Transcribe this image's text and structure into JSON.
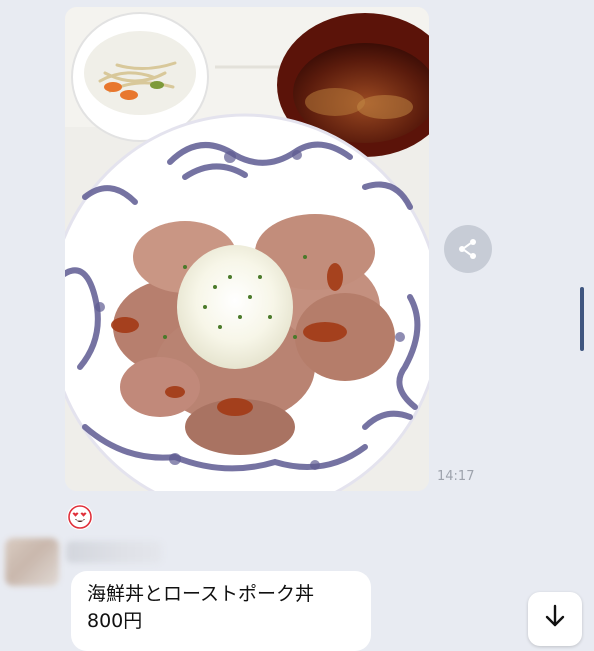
{
  "chat": {
    "photo_message": {
      "alt": "",
      "time": "14:17"
    },
    "reaction": {
      "icon": "heart-eyes-face-icon"
    },
    "text_message": {
      "lines": [
        "海鮮丼とローストポーク丼",
        "800円"
      ]
    }
  },
  "controls": {
    "share_icon": "share-icon",
    "scroll_down_icon": "arrow-down-icon"
  },
  "colors": {
    "background": "#e8ebf2",
    "bubble": "#ffffff",
    "share_button_bg": "#c7ccd6",
    "scroll_indicator": "#3f5680",
    "timestamp": "#9ea3ad",
    "reaction": "#e0303b"
  }
}
